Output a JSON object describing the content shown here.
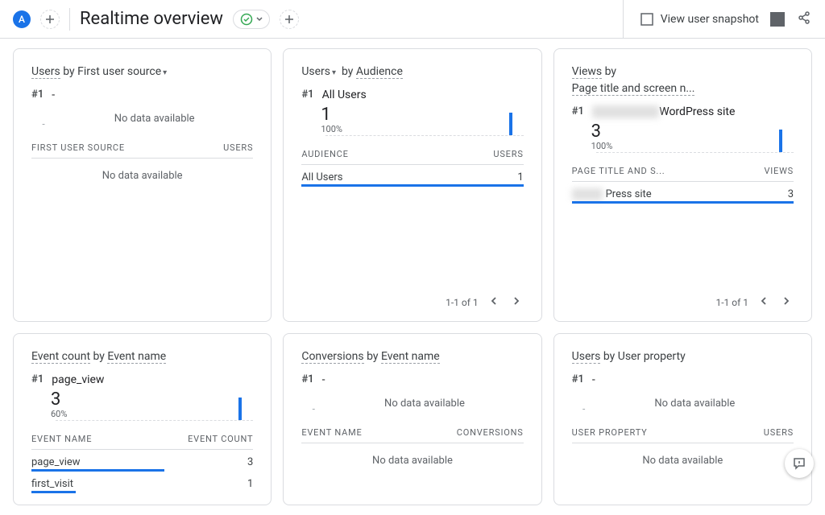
{
  "header": {
    "avatar_letter": "A",
    "page_title": "Realtime overview",
    "snapshot_btn": "View user snapshot"
  },
  "cards": {
    "c1": {
      "metric": "Users",
      "by": "by",
      "dim": "First user source",
      "rank": "#1",
      "label": "-",
      "no_data": "No data available",
      "col1": "FIRST USER SOURCE",
      "col2": "USERS",
      "table_no_data": "No data available"
    },
    "c2": {
      "metric": "Users",
      "by": "by",
      "dim": "Audience",
      "rank": "#1",
      "label": "All Users",
      "num": "1",
      "pct": "100%",
      "col1": "AUDIENCE",
      "col2": "USERS",
      "rows": [
        {
          "label": "All Users",
          "val": "1",
          "bar": "100%"
        }
      ],
      "pager": "1-1 of 1"
    },
    "c3": {
      "metric": "Views",
      "by": "by",
      "dim": "Page title and screen n...",
      "rank": "#1",
      "blur_prefix": "xxxxxxxxxxxx",
      "label_suffix": "WordPress site",
      "num": "3",
      "pct": "100%",
      "col1": "PAGE TITLE AND S...",
      "col2": "VIEWS",
      "rows": [
        {
          "blur": "xxxxxx",
          "label": "Press site",
          "val": "3",
          "bar": "100%"
        }
      ],
      "pager": "1-1 of 1"
    },
    "c4": {
      "metric": "Event count",
      "by": "by",
      "dim": "Event name",
      "rank": "#1",
      "label": "page_view",
      "num": "3",
      "pct": "60%",
      "col1": "EVENT NAME",
      "col2": "EVENT COUNT",
      "rows": [
        {
          "label": "page_view",
          "val": "3",
          "bar": "60%"
        },
        {
          "label": "first_visit",
          "val": "1",
          "bar": "20%"
        }
      ]
    },
    "c5": {
      "metric": "Conversions",
      "by": "by",
      "dim": "Event name",
      "rank": "#1",
      "label": "-",
      "no_data": "No data available",
      "col1": "EVENT NAME",
      "col2": "CONVERSIONS",
      "table_no_data": "No data available"
    },
    "c6": {
      "metric": "Users",
      "by": "by",
      "dim": "User property",
      "rank": "#1",
      "label": "-",
      "no_data": "No data available",
      "col1": "USER PROPERTY",
      "col2": "USERS",
      "table_no_data": "No data available"
    }
  },
  "chart_data": [
    {
      "card": "c2",
      "type": "bar",
      "title": "Users by Audience sparkline",
      "values": [
        0,
        0,
        0,
        0,
        0,
        0,
        0,
        0,
        0,
        0,
        0,
        0,
        0,
        0,
        0,
        0,
        0,
        0,
        0,
        0,
        0,
        0,
        0,
        0,
        0,
        0,
        1,
        0,
        0
      ]
    },
    {
      "card": "c3",
      "type": "bar",
      "title": "Views by Page title sparkline",
      "values": [
        0,
        0,
        0,
        0,
        0,
        0,
        0,
        0,
        0,
        0,
        0,
        0,
        0,
        0,
        0,
        0,
        0,
        0,
        0,
        0,
        0,
        0,
        0,
        0,
        0,
        0,
        0,
        3,
        0
      ]
    },
    {
      "card": "c4",
      "type": "bar",
      "title": "Event count page_view sparkline",
      "values": [
        0,
        0,
        0,
        0,
        0,
        0,
        0,
        0,
        0,
        0,
        0,
        0,
        0,
        0,
        0,
        0,
        0,
        0,
        0,
        0,
        0,
        0,
        0,
        0,
        0,
        0,
        0,
        3,
        0
      ]
    }
  ]
}
